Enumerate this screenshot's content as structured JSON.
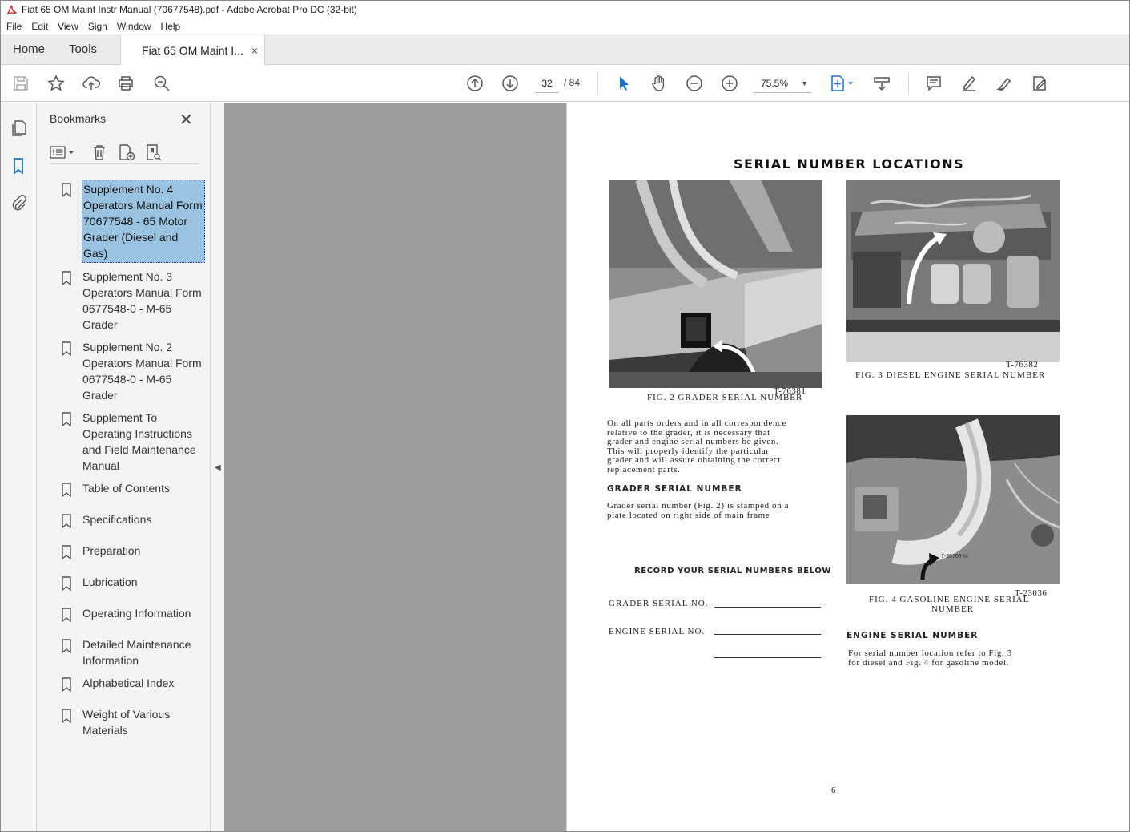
{
  "window": {
    "title": "Fiat 65 OM Maint Instr Manual (70677548).pdf - Adobe Acrobat Pro DC (32-bit)"
  },
  "menu": [
    "File",
    "Edit",
    "View",
    "Sign",
    "Window",
    "Help"
  ],
  "tabs": {
    "home": "Home",
    "tools": "Tools",
    "document": "Fiat 65 OM Maint I...",
    "close": "×"
  },
  "toolbar": {
    "current_page": "32",
    "page_total": "/ 84",
    "zoom": "75.5%"
  },
  "bookmarks": {
    "title": "Bookmarks",
    "close": "✕",
    "items": [
      {
        "label": "Supplement No. 4 Operators Manual Form 70677548 - 65 Motor Grader (Diesel and Gas)",
        "selected": true
      },
      {
        "label": "Supplement No. 3 Operators Manual Form 0677548-0 - M-65 Grader"
      },
      {
        "label": "Supplement No. 2 Operators Manual Form 0677548-0 - M-65 Grader"
      },
      {
        "label": "Supplement To Operating Instructions and Field Maintenance Manual"
      },
      {
        "label": "Table of Contents"
      },
      {
        "label": "Specifications"
      },
      {
        "label": "Preparation"
      },
      {
        "label": "Lubrication"
      },
      {
        "label": "Operating Information"
      },
      {
        "label": "Detailed Maintenance Information"
      },
      {
        "label": "Alphabetical Index"
      },
      {
        "label": "Weight of Various Materials"
      }
    ]
  },
  "page": {
    "title": "SERIAL NUMBER LOCATIONS",
    "fig2": {
      "code": "T-76381",
      "caption": "FIG. 2   GRADER SERIAL NUMBER"
    },
    "fig3": {
      "code": "T-76382",
      "caption": "FIG. 3  DIESEL ENGINE SERIAL NUMBER"
    },
    "fig4": {
      "code": "T-23036",
      "caption_line1": "FIG. 4  GASOLINE ENGINE SERIAL",
      "caption_line2": "NUMBER",
      "plate_text": "7-30703-M"
    },
    "intro_lines": [
      "On all parts orders and in all correspondence",
      "relative to the grader, it is necessary that",
      "grader and engine serial numbers be given.",
      "This will properly identify the particular",
      "grader and will assure obtaining the correct",
      "replacement parts."
    ],
    "grader_heading": "GRADER SERIAL NUMBER",
    "grader_lines": [
      "Grader serial number (Fig. 2) is stamped on a",
      "plate located on right side of main frame"
    ],
    "record_heading": "RECORD YOUR SERIAL NUMBERS BELOW",
    "grader_serial_label": "GRADER SERIAL NO.",
    "engine_serial_label": "ENGINE SERIAL NO.",
    "engine_heading": "ENGINE SERIAL NUMBER",
    "engine_lines": [
      "For serial number location refer to Fig. 3",
      "for diesel and Fig. 4 for gasoline model."
    ],
    "page_number": "6"
  }
}
